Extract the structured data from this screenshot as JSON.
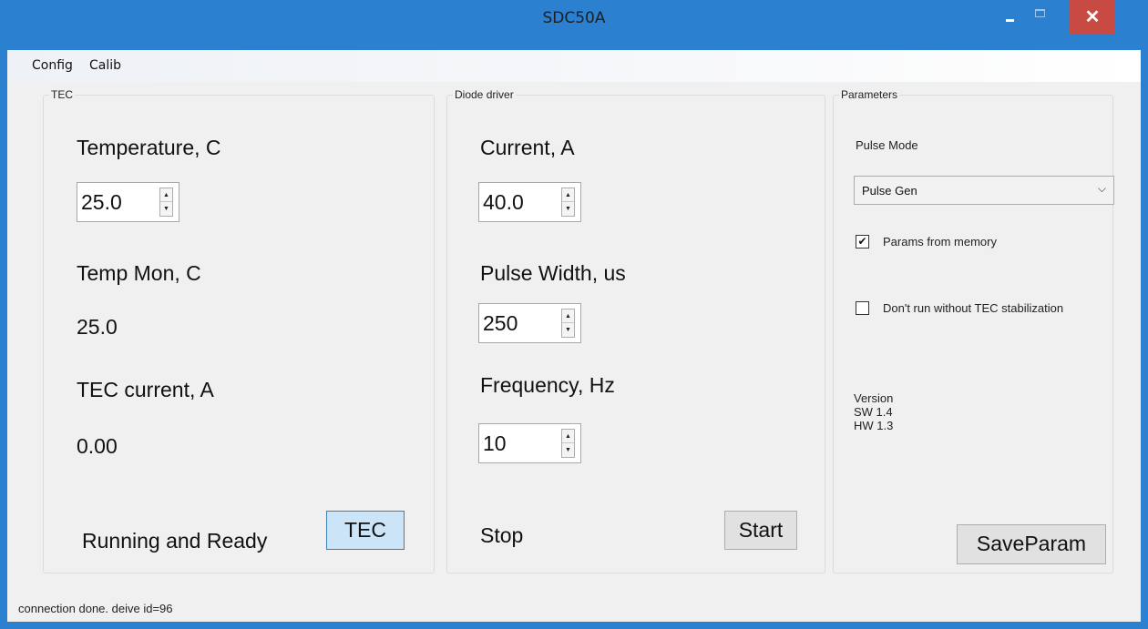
{
  "window": {
    "title": "SDC50A"
  },
  "menu": {
    "config": "Config",
    "calib": "Calib"
  },
  "tec": {
    "group_label": "TEC",
    "temperature_label": "Temperature, C",
    "temperature_value": "25.0",
    "temp_mon_label": "Temp Mon, C",
    "temp_mon_value": "25.0",
    "tec_current_label": "TEC current, A",
    "tec_current_value": "0.00",
    "status_text": "Running and Ready",
    "tec_button": "TEC"
  },
  "diode": {
    "group_label": "Diode driver",
    "current_label": "Current, A",
    "current_value": "40.0",
    "pulse_width_label": "Pulse Width, us",
    "pulse_width_value": "250",
    "frequency_label": "Frequency, Hz",
    "frequency_value": "10",
    "state_text": "Stop",
    "start_button": "Start"
  },
  "params": {
    "group_label": "Parameters",
    "pulse_mode_label": "Pulse Mode",
    "pulse_mode_value": "Pulse Gen",
    "params_from_memory_label": "Params from memory",
    "params_from_memory_checked": true,
    "tec_stab_label": "Don't run without TEC stabilization",
    "tec_stab_checked": false,
    "version_label": "Version",
    "sw_version": "SW 1.4",
    "hw_version": "HW 1.3",
    "save_button": "SaveParam"
  },
  "status_bar": {
    "text": "connection done. deive id=96"
  },
  "colors": {
    "titlebar": "#2b80cf",
    "close": "#c74a43",
    "client": "#f0f0f0",
    "tec_button": "#cce4f7"
  }
}
